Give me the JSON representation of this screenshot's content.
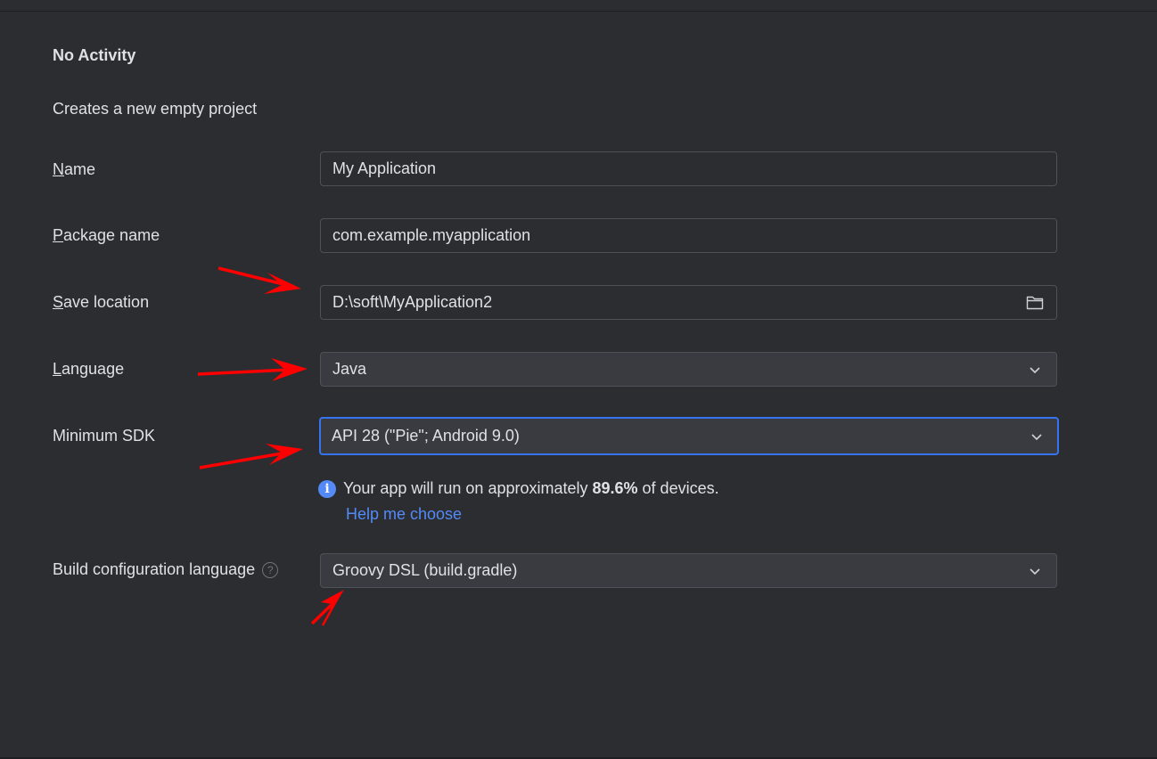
{
  "header": {
    "title": "No Activity",
    "description": "Creates a new empty project"
  },
  "form": {
    "name": {
      "label_mnemonic": "N",
      "label_rest": "ame",
      "value": "My Application"
    },
    "package_name": {
      "label_mnemonic": "P",
      "label_rest": "ackage name",
      "value": "com.example.myapplication"
    },
    "save_location": {
      "label_mnemonic": "S",
      "label_rest": "ave location",
      "value": "D:\\soft\\MyApplication2",
      "icon": "folder-icon"
    },
    "language": {
      "label_mnemonic": "L",
      "label_rest": "anguage",
      "value": "Java",
      "icon": "chevron-down-icon"
    },
    "minimum_sdk": {
      "label": "Minimum SDK",
      "value": "API 28 (\"Pie\"; Android 9.0)",
      "icon": "chevron-down-icon"
    },
    "sdk_info": {
      "icon": "info-icon",
      "text_before": "Your app will run on approximately ",
      "percent": "89.6%",
      "text_after": " of devices.",
      "help_link": "Help me choose"
    },
    "build_config": {
      "label": "Build configuration language",
      "help_icon": "question-mark-icon",
      "value": "Groovy DSL (build.gradle)",
      "icon": "chevron-down-icon"
    }
  },
  "colors": {
    "background": "#2b2d30",
    "field_border": "#4e5157",
    "combo_background": "#393b40",
    "focus_border": "#3574f0",
    "link": "#548af7",
    "annotation_arrow": "#ff0000"
  }
}
